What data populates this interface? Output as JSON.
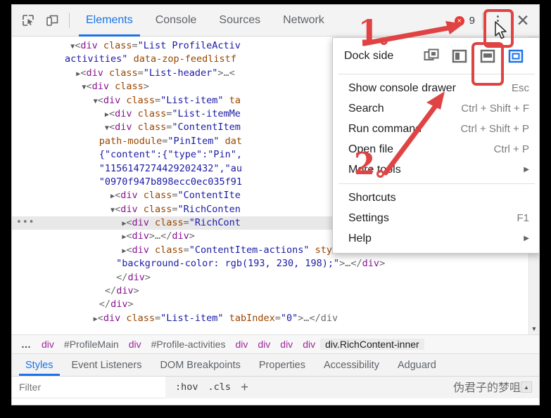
{
  "toolbar": {
    "icons": [
      {
        "name": "inspect-element-icon",
        "label": "Inspect element"
      },
      {
        "name": "device-toolbar-icon",
        "label": "Toggle device toolbar"
      }
    ],
    "tabs": [
      {
        "label": "Elements",
        "active": true
      },
      {
        "label": "Console",
        "active": false
      },
      {
        "label": "Sources",
        "active": false
      },
      {
        "label": "Network",
        "active": false
      }
    ],
    "error_count": "9",
    "error_glyph": "×",
    "more_options_label": "Customize and control DevTools",
    "close_label": "✕"
  },
  "dom_tree": {
    "rows": [
      {
        "indent": 9,
        "tri": "▼",
        "parts": [
          {
            "t": "pun",
            "v": "<"
          },
          {
            "t": "tag",
            "v": "div "
          },
          {
            "t": "attr",
            "v": "class"
          },
          {
            "t": "pun",
            "v": "="
          },
          {
            "t": "val",
            "v": "\"List ProfileActiv"
          }
        ]
      },
      {
        "indent": 8,
        "tri": "",
        "parts": [
          {
            "t": "val",
            "v": "activities\""
          },
          {
            "t": "txt",
            "v": " "
          },
          {
            "t": "attr",
            "v": "data-zop-feedlistf"
          }
        ]
      },
      {
        "indent": 10,
        "tri": "▶",
        "parts": [
          {
            "t": "pun",
            "v": "<"
          },
          {
            "t": "tag",
            "v": "div "
          },
          {
            "t": "attr",
            "v": "class"
          },
          {
            "t": "pun",
            "v": "="
          },
          {
            "t": "val",
            "v": "\"List-header\""
          },
          {
            "t": "pun",
            "v": ">…<"
          }
        ]
      },
      {
        "indent": 11,
        "tri": "▼",
        "parts": [
          {
            "t": "pun",
            "v": "<"
          },
          {
            "t": "tag",
            "v": "div "
          },
          {
            "t": "attr",
            "v": "class"
          },
          {
            "t": "pun",
            "v": ">"
          }
        ]
      },
      {
        "indent": 13,
        "tri": "▼",
        "parts": [
          {
            "t": "pun",
            "v": "<"
          },
          {
            "t": "tag",
            "v": "div "
          },
          {
            "t": "attr",
            "v": "class"
          },
          {
            "t": "pun",
            "v": "="
          },
          {
            "t": "val",
            "v": "\"List-item\""
          },
          {
            "t": "txt",
            "v": " "
          },
          {
            "t": "attr",
            "v": "ta"
          }
        ]
      },
      {
        "indent": 15,
        "tri": "▶",
        "parts": [
          {
            "t": "pun",
            "v": "<"
          },
          {
            "t": "tag",
            "v": "div "
          },
          {
            "t": "attr",
            "v": "class"
          },
          {
            "t": "pun",
            "v": "="
          },
          {
            "t": "val",
            "v": "\"List-itemMe"
          }
        ]
      },
      {
        "indent": 15,
        "tri": "▼",
        "parts": [
          {
            "t": "pun",
            "v": "<"
          },
          {
            "t": "tag",
            "v": "div "
          },
          {
            "t": "attr",
            "v": "class"
          },
          {
            "t": "pun",
            "v": "="
          },
          {
            "t": "val",
            "v": "\"ContentItem"
          }
        ]
      },
      {
        "indent": 14,
        "tri": "",
        "parts": [
          {
            "t": "attr",
            "v": "path-module"
          },
          {
            "t": "pun",
            "v": "="
          },
          {
            "t": "val",
            "v": "\"PinItem\""
          },
          {
            "t": "txt",
            "v": " "
          },
          {
            "t": "attr",
            "v": "dat"
          }
        ]
      },
      {
        "indent": 14,
        "tri": "",
        "parts": [
          {
            "t": "val",
            "v": "{\"content\":{\"type\":\"Pin\","
          }
        ]
      },
      {
        "indent": 14,
        "tri": "",
        "parts": [
          {
            "t": "val",
            "v": "\"1156147274429202432\",\"au"
          }
        ]
      },
      {
        "indent": 14,
        "tri": "",
        "parts": [
          {
            "t": "val",
            "v": "\"0970f947b898ecc0ec035f91"
          }
        ]
      },
      {
        "indent": 16,
        "tri": "▶",
        "parts": [
          {
            "t": "pun",
            "v": "<"
          },
          {
            "t": "tag",
            "v": "div "
          },
          {
            "t": "attr",
            "v": "class"
          },
          {
            "t": "pun",
            "v": "="
          },
          {
            "t": "val",
            "v": "\"ContentIte"
          }
        ]
      },
      {
        "indent": 16,
        "tri": "▼",
        "parts": [
          {
            "t": "pun",
            "v": "<"
          },
          {
            "t": "tag",
            "v": "div "
          },
          {
            "t": "attr",
            "v": "class"
          },
          {
            "t": "pun",
            "v": "="
          },
          {
            "t": "val",
            "v": "\"RichConten"
          }
        ]
      },
      {
        "indent": 18,
        "tri": "▶",
        "selected": true,
        "parts": [
          {
            "t": "pun",
            "v": "<"
          },
          {
            "t": "tag",
            "v": "div "
          },
          {
            "t": "attr",
            "v": "class"
          },
          {
            "t": "pun",
            "v": "="
          },
          {
            "t": "val",
            "v": "\"RichCont"
          }
        ]
      },
      {
        "indent": 18,
        "tri": "▶",
        "parts": [
          {
            "t": "pun",
            "v": "<"
          },
          {
            "t": "tag",
            "v": "div"
          },
          {
            "t": "pun",
            "v": ">…</"
          },
          {
            "t": "tag",
            "v": "div"
          },
          {
            "t": "pun",
            "v": ">"
          }
        ]
      },
      {
        "indent": 18,
        "tri": "▶",
        "parts": [
          {
            "t": "pun",
            "v": "<"
          },
          {
            "t": "tag",
            "v": "div "
          },
          {
            "t": "attr",
            "v": "class"
          },
          {
            "t": "pun",
            "v": "="
          },
          {
            "t": "val",
            "v": "\"ContentItem-actions\""
          },
          {
            "t": "txt",
            "v": " "
          },
          {
            "t": "attr",
            "v": "style"
          },
          {
            "t": "pun",
            "v": "="
          }
        ]
      },
      {
        "indent": 17,
        "tri": "",
        "parts": [
          {
            "t": "val",
            "v": "\"background-color: rgb(193, 230, 198);\""
          },
          {
            "t": "pun",
            "v": ">…</"
          },
          {
            "t": "tag",
            "v": "div"
          },
          {
            "t": "pun",
            "v": ">"
          }
        ]
      },
      {
        "indent": 17,
        "tri": "",
        "parts": [
          {
            "t": "pun",
            "v": "</"
          },
          {
            "t": "tag",
            "v": "div"
          },
          {
            "t": "pun",
            "v": ">"
          }
        ]
      },
      {
        "indent": 15,
        "tri": "",
        "parts": [
          {
            "t": "pun",
            "v": "</"
          },
          {
            "t": "tag",
            "v": "div"
          },
          {
            "t": "pun",
            "v": ">"
          }
        ]
      },
      {
        "indent": 14,
        "tri": "",
        "parts": [
          {
            "t": "pun",
            "v": "</"
          },
          {
            "t": "tag",
            "v": "div"
          },
          {
            "t": "pun",
            "v": ">"
          }
        ]
      },
      {
        "indent": 13,
        "tri": "▶",
        "parts": [
          {
            "t": "pun",
            "v": "<"
          },
          {
            "t": "tag",
            "v": "div "
          },
          {
            "t": "attr",
            "v": "class"
          },
          {
            "t": "pun",
            "v": "="
          },
          {
            "t": "val",
            "v": "\"List-item\""
          },
          {
            "t": "txt",
            "v": " "
          },
          {
            "t": "attr",
            "v": "tabIndex"
          },
          {
            "t": "pun",
            "v": "="
          },
          {
            "t": "val",
            "v": "\"0\""
          },
          {
            "t": "pun",
            "v": ">…</div"
          }
        ]
      }
    ],
    "ellipsis_marker": "•••"
  },
  "breadcrumb": {
    "items": [
      {
        "label": "…",
        "kind": "ellipsis"
      },
      {
        "label": "div",
        "kind": "tagname"
      },
      {
        "label": "#ProfileMain",
        "kind": "plain"
      },
      {
        "label": "div",
        "kind": "tagname"
      },
      {
        "label": "#Profile-activities",
        "kind": "plain"
      },
      {
        "label": "div",
        "kind": "tagname"
      },
      {
        "label": "div",
        "kind": "tagname"
      },
      {
        "label": "div",
        "kind": "tagname"
      },
      {
        "label": "div",
        "kind": "tagname"
      },
      {
        "label": "div.RichContent-inner",
        "kind": "active"
      }
    ]
  },
  "styles_pane": {
    "tabs": [
      {
        "label": "Styles",
        "active": true
      },
      {
        "label": "Event Listeners",
        "active": false
      },
      {
        "label": "DOM Breakpoints",
        "active": false
      },
      {
        "label": "Properties",
        "active": false
      },
      {
        "label": "Accessibility",
        "active": false
      },
      {
        "label": "Adguard",
        "active": false
      }
    ],
    "filter_placeholder": "Filter",
    "filter_value": "",
    "hov_label": ":hov",
    "cls_label": ".cls",
    "new_rule_label": "+",
    "caret_label": "▲",
    "watermark": "伪君子的梦咀"
  },
  "menu": {
    "dock_side_label": "Dock side",
    "dock_options": [
      {
        "name": "undock-into-separate-window-icon",
        "active": false
      },
      {
        "name": "dock-to-left-icon",
        "active": false
      },
      {
        "name": "dock-to-bottom-icon",
        "active": false
      },
      {
        "name": "dock-to-right-icon",
        "active": true
      }
    ],
    "items_group1": [
      {
        "label": "Show console drawer",
        "shortcut": "Esc",
        "submenu": false
      },
      {
        "label": "Search",
        "shortcut": "Ctrl + Shift + F",
        "submenu": false
      },
      {
        "label": "Run command",
        "shortcut": "Ctrl + Shift + P",
        "submenu": false
      },
      {
        "label": "Open file",
        "shortcut": "Ctrl + P",
        "submenu": false
      },
      {
        "label": "More tools",
        "shortcut": "",
        "submenu": true
      }
    ],
    "items_group2": [
      {
        "label": "Shortcuts",
        "shortcut": "",
        "submenu": false
      },
      {
        "label": "Settings",
        "shortcut": "F1",
        "submenu": false
      },
      {
        "label": "Help",
        "shortcut": "",
        "submenu": true
      }
    ]
  },
  "annotations": {
    "accent_color": "#e04343",
    "marks": [
      {
        "label": "1",
        "suffix": "."
      },
      {
        "label": "2",
        "suffix": "."
      }
    ]
  },
  "colors": {
    "accent_blue": "#1a73e8",
    "error_red": "#e53935",
    "annotation_red": "#e04343",
    "tag_purple": "#881391",
    "attr_orange": "#994500",
    "value_blue": "#1a1aa6"
  }
}
